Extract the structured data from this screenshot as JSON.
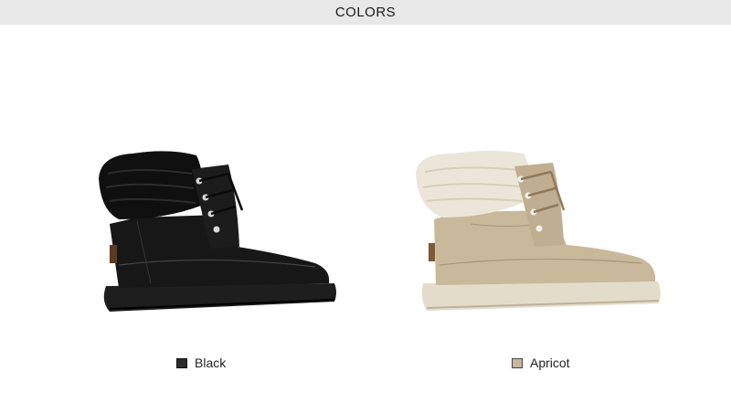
{
  "header": {
    "title": "COLORS"
  },
  "variants": [
    {
      "label": "Black",
      "swatch_color": "#2b2b2b",
      "icon": "black-boot"
    },
    {
      "label": "Apricot",
      "swatch_color": "#c8b79c",
      "icon": "apricot-boot"
    }
  ]
}
